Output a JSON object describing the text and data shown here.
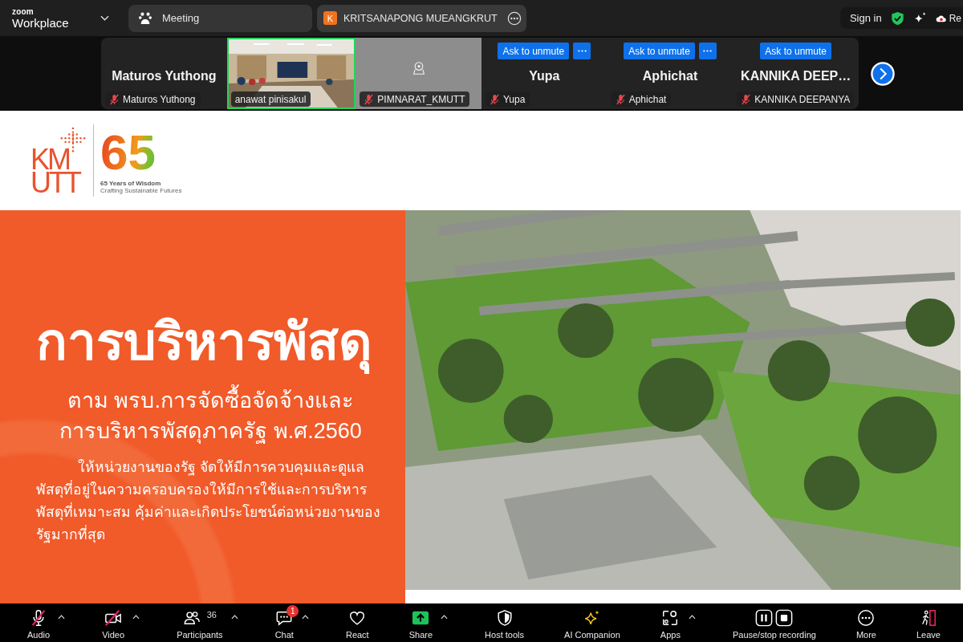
{
  "app": {
    "brand_small": "zoom",
    "brand": "Workplace"
  },
  "tabs": [
    {
      "kind": "meeting",
      "label": "Meeting"
    },
    {
      "kind": "contact",
      "initial": "K",
      "label": "KRITSANAPONG MUEANGKRUT"
    }
  ],
  "account": {
    "sign_in": "Sign in",
    "recording": "Re"
  },
  "gallery": {
    "tiles": [
      {
        "kind": "name",
        "display_name": "Maturos Yuthong",
        "label": "Maturos Yuthong",
        "muted": true,
        "speaking": false,
        "more": false
      },
      {
        "kind": "video",
        "label": "anawat pinisakul",
        "muted": false,
        "speaking": true,
        "more": false
      },
      {
        "kind": "camera",
        "label": "PIMNARAT_KMUTT",
        "muted": true,
        "speaking": false,
        "more": false
      },
      {
        "kind": "name",
        "ask_button": "Ask to unmute",
        "display_name": "Yupa",
        "label": "Yupa",
        "muted": true,
        "speaking": false,
        "more": true
      },
      {
        "kind": "name",
        "ask_button": "Ask to unmute",
        "display_name": "Aphichat",
        "label": "Aphichat",
        "muted": true,
        "speaking": false,
        "more": true
      },
      {
        "kind": "name",
        "ask_button": "Ask to unmute",
        "display_name": "KANNIKA DEEP…",
        "label": "KANNIKA DEEPANYA",
        "muted": true,
        "speaking": false,
        "more": false
      }
    ]
  },
  "slide": {
    "logo": {
      "wordmark_lines": [
        "KM",
        "UTT"
      ],
      "mark": "65",
      "tagline": "65 Years of Wisdom",
      "motto": "Crafting Sustainable Futures"
    },
    "title": "การบริหารพัสดุ",
    "subtitle_lines": [
      "ตาม พรบ.การจัดซื้อจัดจ้างและ",
      "การบริหารพัสดุภาครัฐ พ.ศ.2560"
    ],
    "body": "ให้หน่วยงานของรัฐ จัดให้มีการควบคุมและดูแลพัสดุที่อยู่ในความครอบครองให้มีการใช้และการบริหารพัสดุที่เหมาะสม คุ้มค่าและเกิดประโยชน์ต่อหน่วยงานของรัฐมากที่สุด"
  },
  "toolbar": {
    "media": [
      {
        "kind": "audio",
        "label": "Audio",
        "off": true,
        "caret": true
      },
      {
        "kind": "video",
        "label": "Video",
        "off": true,
        "caret": true
      }
    ],
    "items": [
      {
        "kind": "participants",
        "label": "Participants",
        "count": "36",
        "caret": true
      },
      {
        "kind": "chat",
        "label": "Chat",
        "badge": "1",
        "caret": true
      },
      {
        "kind": "react",
        "label": "React",
        "caret": false
      },
      {
        "kind": "share",
        "label": "Share",
        "caret": true
      },
      {
        "kind": "host",
        "label": "Host tools",
        "caret": false
      },
      {
        "kind": "ai",
        "label": "AI Companion",
        "caret": false
      },
      {
        "kind": "apps",
        "label": "Apps",
        "caret": true
      },
      {
        "kind": "record",
        "label": "Pause/stop recording",
        "caret": false
      },
      {
        "kind": "more",
        "label": "More",
        "caret": false
      },
      {
        "kind": "leave",
        "label": "Leave",
        "caret": false
      }
    ]
  }
}
